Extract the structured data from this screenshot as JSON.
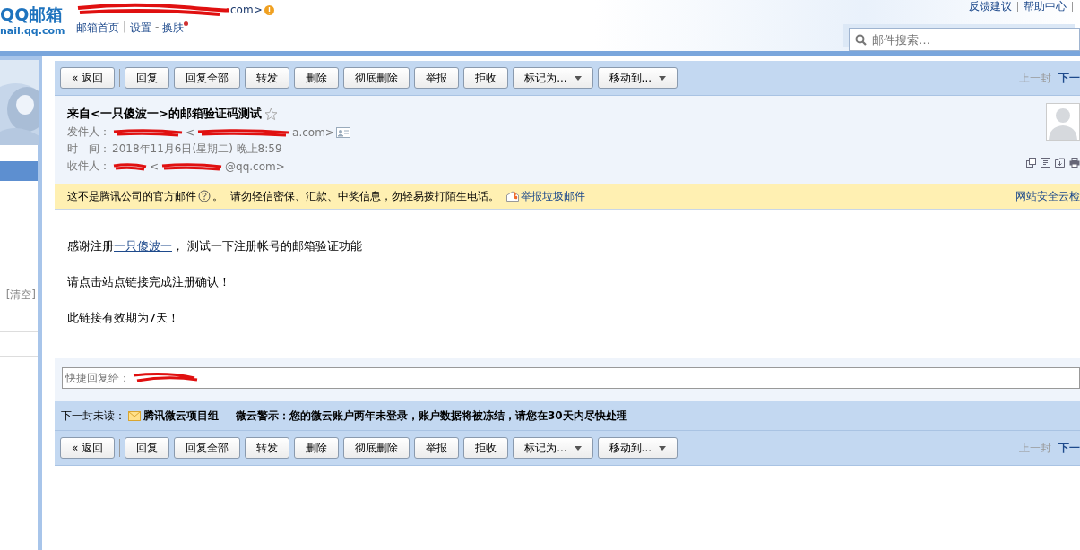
{
  "header": {
    "logo": "QQ邮箱",
    "logo_domain": "nail.qq.com",
    "account_tail": "com>",
    "nav": [
      {
        "label": "邮箱首页",
        "sep": "|"
      },
      {
        "label": "设置",
        "sep": "-"
      },
      {
        "label": "换肤"
      }
    ],
    "top_links": [
      {
        "label": "反馈建议"
      },
      {
        "label": "帮助中心"
      }
    ],
    "search": {
      "placeholder": "邮件搜索…"
    }
  },
  "sidebar": {
    "clear_label": "[清空]"
  },
  "toolbar_top": {
    "buttons": [
      {
        "label": "« 返回",
        "kind": "button"
      },
      {
        "label": "回复",
        "kind": "button"
      },
      {
        "label": "回复全部",
        "kind": "button"
      },
      {
        "label": "转发",
        "kind": "button"
      },
      {
        "label": "删除",
        "kind": "button"
      },
      {
        "label": "彻底删除",
        "kind": "button"
      },
      {
        "label": "举报",
        "kind": "button"
      },
      {
        "label": "拒收",
        "kind": "button"
      },
      {
        "label": "标记为...",
        "kind": "dropdown"
      },
      {
        "label": "移动到...",
        "kind": "dropdown"
      }
    ],
    "pager": [
      {
        "label": "上一封",
        "disabled": true
      },
      {
        "label": "下一",
        "disabled": false
      }
    ]
  },
  "mail": {
    "subject": "来自<一只傻波一>的邮箱验证码测试",
    "starred": false,
    "sender": {
      "label": "发件人：",
      "open": "<",
      "address_tail": "a.com>"
    },
    "time": {
      "label": "时　间：",
      "value": "2018年11月6日(星期二) 晚上8:59"
    },
    "recipient": {
      "label": "收件人：",
      "open": "<",
      "address_tail": "@qq.com>"
    }
  },
  "warning": {
    "title": "这不是腾讯公司的官方邮件",
    "tip": "。  请勿轻信密保、汇款、中奖信息，勿轻易拨打陌生电话。",
    "report": "举报垃圾邮件",
    "right": "网站安全云检"
  },
  "body": {
    "paragraphs": [
      {
        "before": "感谢注册",
        "link": "一只傻波一",
        "after": "， 测试一下注册帐号的邮箱验证功能"
      },
      {
        "before": "请点击站点链接完成注册确认！"
      },
      {
        "before": "此链接有效期为7天！"
      }
    ]
  },
  "quick_reply": {
    "placeholder": "快捷回复给："
  },
  "next_unread": {
    "label": "下一封未读：",
    "sender": "腾讯微云项目组",
    "subject": "微云警示：您的微云账户两年未登录，账户数据将被冻结，请您在30天内尽快处理"
  },
  "toolbar_bottom": {
    "buttons": [
      {
        "label": "« 返回",
        "kind": "button"
      },
      {
        "label": "回复",
        "kind": "button"
      },
      {
        "label": "回复全部",
        "kind": "button"
      },
      {
        "label": "转发",
        "kind": "button"
      },
      {
        "label": "删除",
        "kind": "button"
      },
      {
        "label": "彻底删除",
        "kind": "button"
      },
      {
        "label": "举报",
        "kind": "button"
      },
      {
        "label": "拒收",
        "kind": "button"
      },
      {
        "label": "标记为...",
        "kind": "dropdown"
      },
      {
        "label": "移动到...",
        "kind": "dropdown"
      }
    ],
    "pager": [
      {
        "label": "上一封",
        "disabled": true
      },
      {
        "label": "下一",
        "disabled": false
      }
    ]
  }
}
